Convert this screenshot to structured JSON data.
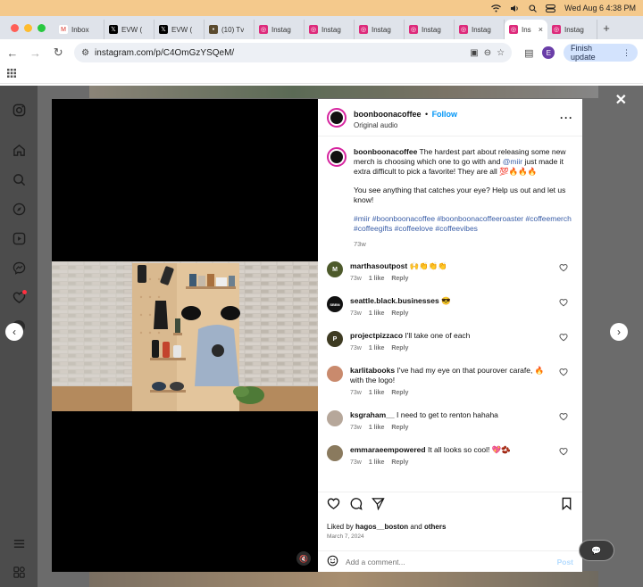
{
  "menubar": {
    "datetime": "Wed Aug 6  4:38 PM"
  },
  "colors": {
    "instagram_blue": "#0095f6",
    "page_dim": "#6b6b6b",
    "menubar": "#f4c98c"
  },
  "tabs": [
    {
      "icon": "gmail-icon",
      "title": "Inbox"
    },
    {
      "icon": "x-icon",
      "title": "EVW ("
    },
    {
      "icon": "x-icon",
      "title": "EVW ("
    },
    {
      "icon": "coffee-icon",
      "title": "(10) Tv"
    },
    {
      "icon": "instagram-icon",
      "title": "Instag"
    },
    {
      "icon": "instagram-icon",
      "title": "Instag"
    },
    {
      "icon": "instagram-icon",
      "title": "Instag"
    },
    {
      "icon": "instagram-icon",
      "title": "Instag"
    },
    {
      "icon": "instagram-icon",
      "title": "Instag"
    },
    {
      "icon": "instagram-icon",
      "title": "Ins",
      "active": true
    },
    {
      "icon": "instagram-icon",
      "title": "Instag"
    }
  ],
  "toolbar": {
    "url": "instagram.com/p/C4OmGzYSQeM/",
    "profile_initial": "E",
    "finish_update": "Finish update"
  },
  "post": {
    "username": "boonboonacoffee",
    "follow": "Follow",
    "audio": "Original audio",
    "caption_user": "boonboonacoffee",
    "caption_text_1": "The hardest part about releasing some new merch is choosing which one to go with and ",
    "caption_mention": "@miir",
    "caption_text_2": " just made it extra difficult to pick a favorite! They are all 💯🔥🔥🔥",
    "caption_para_2": "You see anything that catches your eye? Help us out and let us know!",
    "hashtags": "#miir #boonboonacoffee #boonboonacoffeeroaster #coffeemerch #coffeegifts #coffeelove #coffeevibes",
    "caption_age": "73w",
    "comments": [
      {
        "user": "marthasoutpost",
        "text": "🙌👏👏👏",
        "age": "73w",
        "likes": "1 like",
        "reply": "Reply",
        "avatar_color": "#4d5a2b",
        "avatar_letter": "M"
      },
      {
        "user": "seattle.black.businesses",
        "text": "😎",
        "age": "73w",
        "likes": "1 like",
        "reply": "Reply",
        "avatar_color": "#111111",
        "avatar_letter": "SBBN"
      },
      {
        "user": "projectpizzaco",
        "text": "I'll take one of each",
        "age": "73w",
        "likes": "1 like",
        "reply": "Reply",
        "avatar_color": "#3e3b22",
        "avatar_letter": "P"
      },
      {
        "user": "karlitabooks",
        "text": "I've had my eye on that pourover carafe, 🔥 with the logo!",
        "age": "73w",
        "likes": "1 like",
        "reply": "Reply",
        "avatar_color": "#c98a6d",
        "avatar_letter": ""
      },
      {
        "user": "ksgraham__",
        "text": "I need to get to renton hahaha",
        "age": "73w",
        "likes": "1 like",
        "reply": "Reply",
        "avatar_color": "#b6a79a",
        "avatar_letter": ""
      },
      {
        "user": "emmaraeempowered",
        "text": "It all looks so cool! 💖🫘",
        "age": "73w",
        "likes": "1 like",
        "reply": "Reply",
        "avatar_color": "#8a7a5e",
        "avatar_letter": ""
      }
    ],
    "liked_by_prefix": "Liked by ",
    "liked_by_user": "hagos__boston",
    "liked_by_and": " and ",
    "liked_by_others": "others",
    "date": "March 7, 2024",
    "add_comment_placeholder": "Add a comment...",
    "post_label": "Post"
  }
}
